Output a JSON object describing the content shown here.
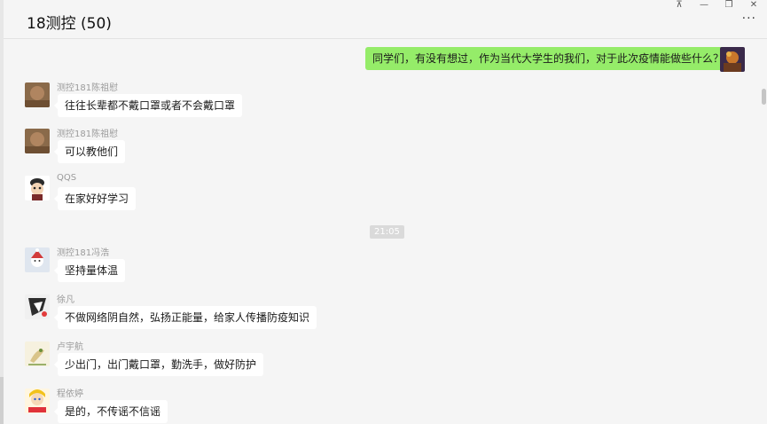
{
  "window": {
    "title": "18测控 (50)",
    "controls": [
      "pin",
      "minimize",
      "restore",
      "close"
    ],
    "more_label": "···"
  },
  "time_divider": "21:05",
  "messages": [
    {
      "sender": "",
      "text": "同学们，有没有想过，作为当代大学生的我们，对于此次疫情能做些什么？",
      "self": true
    },
    {
      "sender": "测控181陈祖慰",
      "text": "往往长辈都不戴口罩或者不会戴口罩"
    },
    {
      "sender": "测控181陈祖慰",
      "text": "可以教他们"
    },
    {
      "sender": "QQS",
      "text": "在家好好学习"
    },
    {
      "sender": "测控181冯浩",
      "text": "坚持量体温"
    },
    {
      "sender": "徐凡",
      "text": "不做网络阴自然，弘扬正能量，给家人传播防疫知识"
    },
    {
      "sender": "卢宇航",
      "text": "少出门，出门戴口罩，勤洗手，做好防护"
    },
    {
      "sender": "程依婷",
      "text": "是的，不传谣不信谣"
    }
  ],
  "avatars": [
    "self-avatar",
    "brown-avatar",
    "brown-avatar",
    "cartoon-avatar",
    "santa-avatar",
    "anime-avatar",
    "bird-avatar",
    "sailor-avatar"
  ]
}
